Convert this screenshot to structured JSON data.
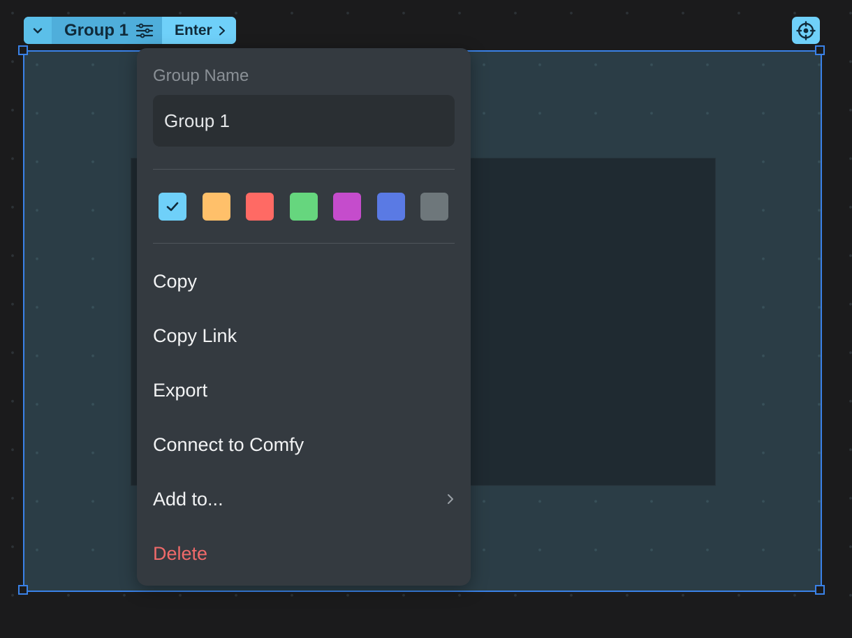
{
  "toolbar": {
    "group_title": "Group 1",
    "enter_label": "Enter",
    "accent": "#6fd0f9"
  },
  "menu": {
    "name_label": "Group Name",
    "name_value": "Group 1",
    "swatches": [
      {
        "color": "#6fd0f9",
        "selected": true
      },
      {
        "color": "#ffc06a",
        "selected": false
      },
      {
        "color": "#ff6a64",
        "selected": false
      },
      {
        "color": "#66d67e",
        "selected": false
      },
      {
        "color": "#c54ccc",
        "selected": false
      },
      {
        "color": "#5a7ae4",
        "selected": false
      },
      {
        "color": "#6e777b",
        "selected": false
      }
    ],
    "items": {
      "copy": "Copy",
      "copy_link": "Copy Link",
      "export": "Export",
      "connect": "Connect to Comfy",
      "add_to": "Add to...",
      "delete": "Delete"
    },
    "delete_color": "#f06a6a"
  },
  "icons": {
    "collapse": "chevron-down-icon",
    "settings": "sliders-icon",
    "enter": "chevron-right-icon",
    "focus": "crosshair-icon",
    "submenu": "chevron-right-icon",
    "selected": "check-icon"
  }
}
